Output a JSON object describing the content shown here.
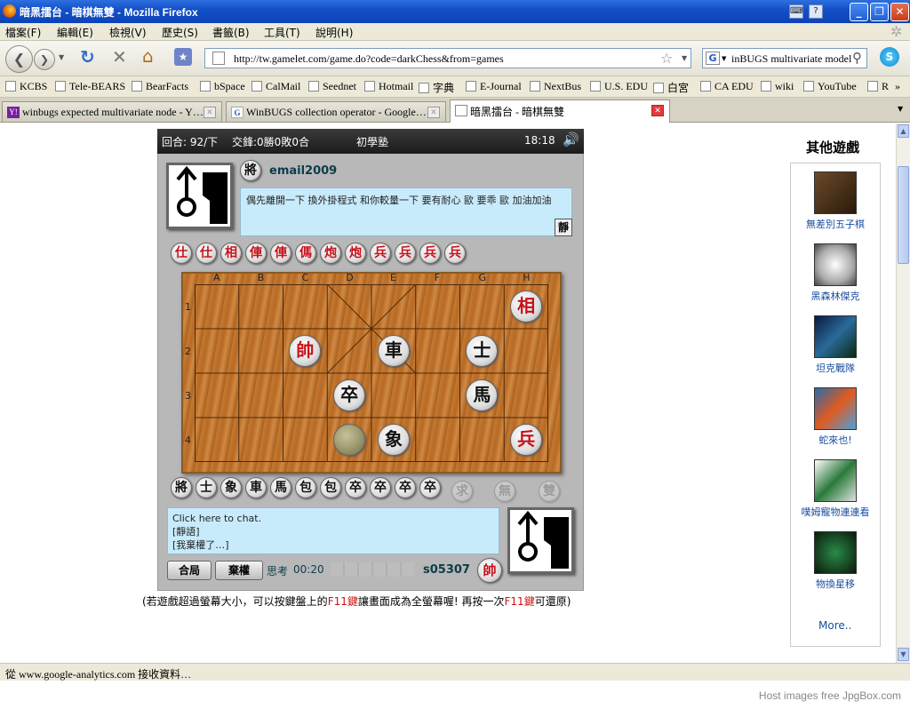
{
  "window": {
    "title": "暗黑擂台 - 暗棋無雙 - Mozilla Firefox"
  },
  "menu": [
    "檔案(F)",
    "編輯(E)",
    "檢視(V)",
    "歷史(S)",
    "書籤(B)",
    "工具(T)",
    "說明(H)"
  ],
  "nav": {
    "url": "http://tw.gamelet.com/game.do?code=darkChess&from=games",
    "search_value": "inBUGS multivariate model"
  },
  "bookmarks": [
    "KCBS",
    "Tele-BEARS",
    "BearFacts",
    "bSpace",
    "CalMail",
    "Seednet",
    "Hotmail",
    "字典",
    "E-Journal",
    "NextBus",
    "U.S. EDU",
    "白宮",
    "CA EDU",
    "wiki",
    "YouTube",
    "R"
  ],
  "tabs": [
    {
      "label": "winbugs expected multivariate node - Y…",
      "active": false
    },
    {
      "label": "WinBUGS collection operator - Google…",
      "active": false
    },
    {
      "label": "暗黑擂台 - 暗棋無雙",
      "active": true
    }
  ],
  "game": {
    "round": "回合: 92/下",
    "record": "交鋒:0勝0敗0合",
    "room": "初學塾",
    "clock": "18:18",
    "opponent": {
      "rank": "將",
      "name": "email2009"
    },
    "opponent_message": "偶先離開一下 換外掛程式 和你較量一下 要有耐心 歐 要乖 歐 加油加油",
    "mute_label": "靜",
    "captured_red": [
      "仕",
      "仕",
      "相",
      "俥",
      "俥",
      "傌",
      "炮",
      "炮",
      "兵",
      "兵",
      "兵",
      "兵"
    ],
    "captured_black": [
      "將",
      "士",
      "象",
      "車",
      "馬",
      "包",
      "包",
      "卒",
      "卒",
      "卒",
      "卒"
    ],
    "faded_buttons": [
      "求",
      "無",
      "雙"
    ],
    "columns": [
      "A",
      "B",
      "C",
      "D",
      "E",
      "F",
      "G",
      "H"
    ],
    "rows": [
      "1",
      "2",
      "3",
      "4"
    ],
    "board_pieces": [
      {
        "label": "相",
        "color": "red",
        "col": 7,
        "row": 0
      },
      {
        "label": "帥",
        "color": "red",
        "col": 2,
        "row": 1
      },
      {
        "label": "車",
        "color": "black",
        "col": 4,
        "row": 1
      },
      {
        "label": "士",
        "color": "black",
        "col": 6,
        "row": 1
      },
      {
        "label": "卒",
        "color": "black",
        "col": 3,
        "row": 2
      },
      {
        "label": "馬",
        "color": "black",
        "col": 6,
        "row": 2
      },
      {
        "label": "",
        "color": "hidden",
        "col": 3,
        "row": 3
      },
      {
        "label": "象",
        "color": "black",
        "col": 4,
        "row": 3
      },
      {
        "label": "兵",
        "color": "red",
        "col": 7,
        "row": 3
      }
    ],
    "chat": [
      "Click here to chat.",
      "[靜語]",
      "[我棄權了…]"
    ],
    "draw_button": "合局",
    "resign_button": "棄權",
    "thinking_label": "思考",
    "thinking_time": "00:20",
    "player": {
      "name": "s05307",
      "rank": "帥"
    },
    "hint_prefix": "(若遊戲超過螢幕大小，可以按鍵盤上的",
    "hint_key1": "F11鍵",
    "hint_mid": "讓畫面成為全螢幕喔! 再按一次",
    "hint_key2": "F11鍵",
    "hint_suffix": "可還原)"
  },
  "other_games": {
    "title": "其他遊戲",
    "items": [
      "無差別五子棋",
      "黑森林傑克",
      "坦克戰隊",
      "蛇來也!",
      "噗姆寵物連連看",
      "物換星移"
    ],
    "more": "More.."
  },
  "status": "從 www.google-analytics.com 接收資料…",
  "footer": "Host images free JpgBox.com"
}
